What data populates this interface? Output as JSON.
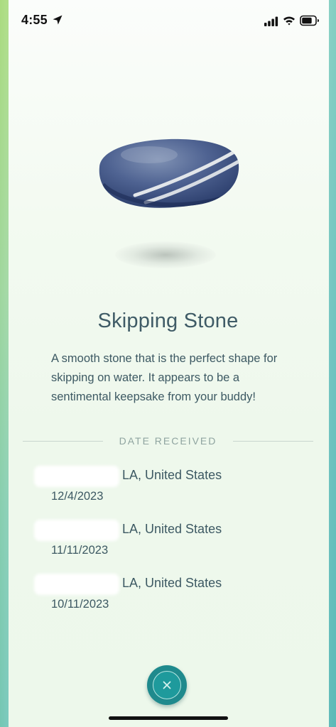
{
  "status_bar": {
    "time": "4:55",
    "location_icon": "location-arrow-icon",
    "signal_icon": "cellular-signal-icon",
    "wifi_icon": "wifi-icon",
    "battery_icon": "battery-icon"
  },
  "item": {
    "image_icon": "skipping-stone-icon",
    "title": "Skipping Stone",
    "description": "A smooth stone that is the perfect shape for skipping on water. It appears to be a sentimental keepsake from your buddy!"
  },
  "date_section": {
    "label": "DATE RECEIVED",
    "entries": [
      {
        "location": "LA, United States",
        "date": "12/4/2023"
      },
      {
        "location": "LA, United States",
        "date": "11/11/2023"
      },
      {
        "location": "LA, United States",
        "date": "10/11/2023"
      }
    ]
  },
  "close_button": {
    "icon": "close-icon"
  },
  "colors": {
    "accent": "#1f8a8d",
    "text": "#3d5963",
    "title": "#3f5b66",
    "section_label": "#8fa4a0"
  }
}
